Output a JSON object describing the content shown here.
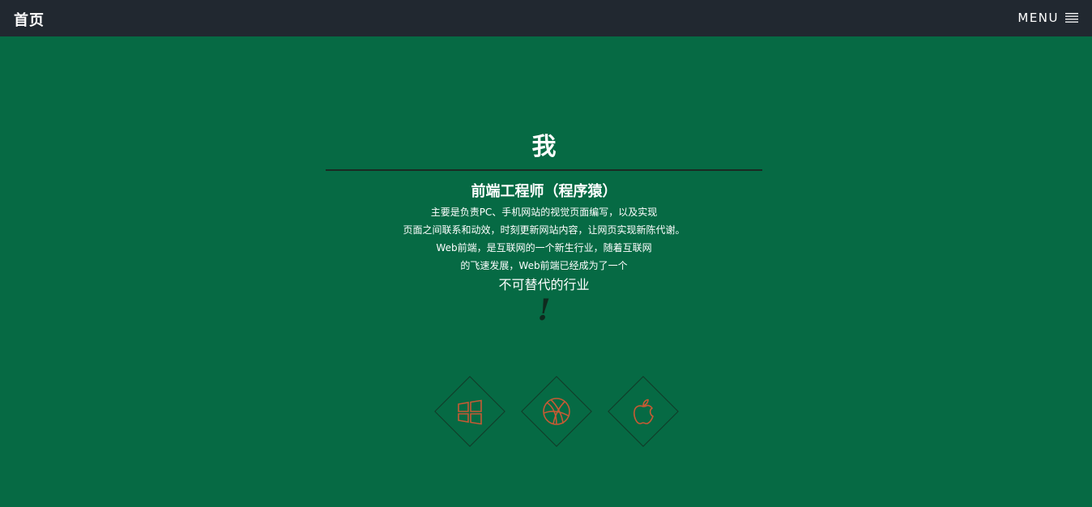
{
  "nav": {
    "brand": "首页",
    "menu_label": "MENU",
    "menu_icon": "hamburger-icon"
  },
  "hero": {
    "title": "我",
    "subtitle": "前端工程师（程序猿）",
    "description_lines": [
      "主要是负责PC、手机网站的视觉页面编写，以及实现",
      "页面之间联系和动效，时刻更新网站内容，让网页实现新陈代谢。",
      "Web前端，是互联网的一个新生行业，随着互联网",
      "的飞速发展，Web前端已经成为了一个"
    ],
    "emphasis": "不可替代的行业",
    "exclaim": "!"
  },
  "platform_icons": [
    {
      "name": "windows-icon"
    },
    {
      "name": "basketball-icon"
    },
    {
      "name": "apple-icon"
    }
  ],
  "colors": {
    "background": "#066a44",
    "navbar": "#212830",
    "icon_accent": "#c65a34",
    "divider": "#1a2a22",
    "text": "#ffffff"
  }
}
